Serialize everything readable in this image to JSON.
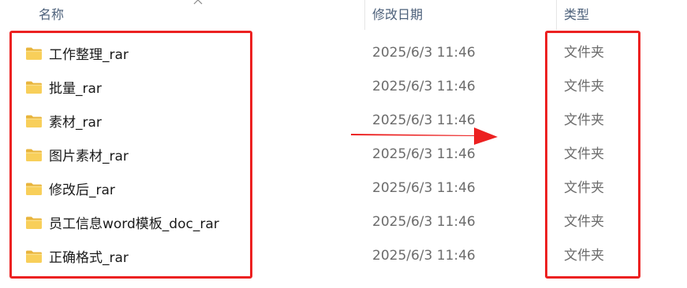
{
  "header": {
    "name_label": "名称",
    "date_label": "修改日期",
    "type_label": "类型"
  },
  "rows": [
    {
      "name": "工作整理_rar",
      "date": "2025/6/3 11:46",
      "type": "文件夹"
    },
    {
      "name": "批量_rar",
      "date": "2025/6/3 11:46",
      "type": "文件夹"
    },
    {
      "name": "素材_rar",
      "date": "2025/6/3 11:46",
      "type": "文件夹"
    },
    {
      "name": "图片素材_rar",
      "date": "2025/6/3 11:46",
      "type": "文件夹"
    },
    {
      "name": "修改后_rar",
      "date": "2025/6/3 11:46",
      "type": "文件夹"
    },
    {
      "name": "员工信息word模板_doc_rar",
      "date": "2025/6/3 11:46",
      "type": "文件夹"
    },
    {
      "name": "正确格式_rar",
      "date": "2025/6/3 11:46",
      "type": "文件夹"
    }
  ],
  "icons": {
    "row_icon": "folder-icon",
    "sort_indicator": "sort-ascending-icon",
    "annotation_arrow": "red-arrow-icon"
  },
  "colors": {
    "annotation": "#ec2121",
    "folder_fill": "#f8cf5a",
    "folder_tab": "#e8b43c",
    "header_text": "#4c607a",
    "secondary_text": "#6b6b6b"
  }
}
